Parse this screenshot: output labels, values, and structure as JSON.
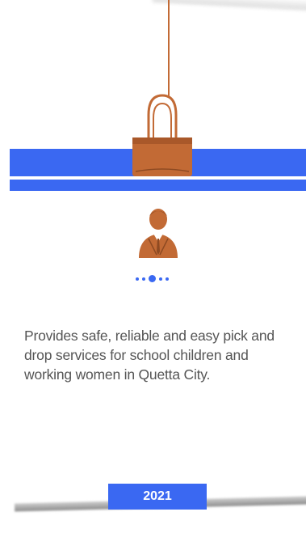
{
  "card": {
    "description": "Provides safe, reliable and easy pick and drop services for school children and working women in Quetta City.",
    "year": "2021"
  },
  "carousel": {
    "dot_count": 5,
    "active_index": 2
  },
  "icons": {
    "clip": "binder-clip-icon",
    "avatar": "businessman-icon"
  },
  "colors": {
    "accent": "#3a68f2",
    "clip": "#c26a35",
    "text": "#555555"
  }
}
